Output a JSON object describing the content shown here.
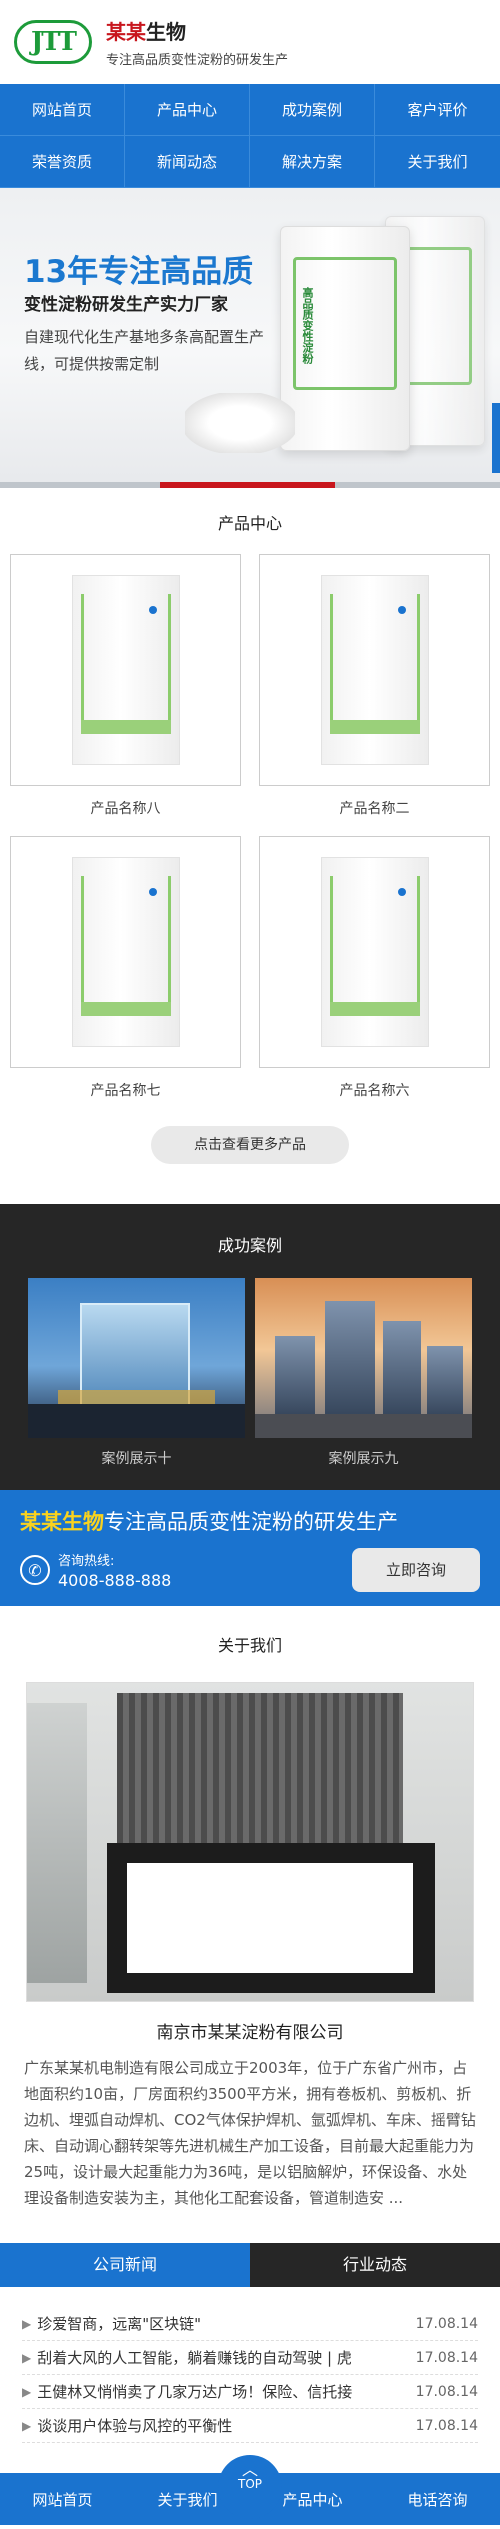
{
  "header": {
    "logo_mark": "JTT",
    "brand_red": "某某",
    "brand_rest": "生物",
    "slogan": "专注高品质变性淀粉的研发生产"
  },
  "nav": [
    "网站首页",
    "产品中心",
    "成功案例",
    "客户评价",
    "荣誉资质",
    "新闻动态",
    "解决方案",
    "关于我们"
  ],
  "banner": {
    "title": "13年专注高品质",
    "subtitle": "变性淀粉研发生产实力厂家",
    "desc": "自建现代化生产基地多条高配置生产线，可提供按需定制",
    "bag_text": "高品质变性淀粉"
  },
  "products": {
    "title": "产品中心",
    "items": [
      "产品名称八",
      "产品名称二",
      "产品名称七",
      "产品名称六"
    ],
    "more": "点击查看更多产品"
  },
  "cases": {
    "title": "成功案例",
    "items": [
      "案例展示十",
      "案例展示九"
    ]
  },
  "promo": {
    "brand": "某某生物",
    "text": "专注高品质变性淀粉的研发生产",
    "hotline_label": "咨询热线:",
    "hotline": "4008-888-888",
    "consult": "立即咨询"
  },
  "about": {
    "title": "关于我们",
    "company": "南京市某某淀粉有限公司",
    "text": "广东某某机电制造有限公司成立于2003年，位于广东省广州市，占地面积约10亩，厂房面积约3500平方米，拥有卷板机、剪板机、折边机、埋弧自动焊机、CO2气体保护焊机、氩弧焊机、车床、摇臂钻床、自动调心翻转架等先进机械生产加工设备，目前最大起重能力为25吨，设计最大起重能力为36吨，是以铝脑解炉，环保设备、水处理设备制造安装为主，其他化工配套设备，管道制造安 ..."
  },
  "news": {
    "tabs": [
      "公司新闻",
      "行业动态"
    ],
    "items": [
      {
        "title": "珍爱智商，远离\"区块链\"",
        "date": "17.08.14"
      },
      {
        "title": "刮着大风的人工智能，躺着赚钱的自动驾驶 | 虎",
        "date": "17.08.14"
      },
      {
        "title": "王健林又悄悄卖了几家万达广场！保险、信托接",
        "date": "17.08.14"
      },
      {
        "title": "谈谈用户体验与风控的平衡性",
        "date": "17.08.14"
      }
    ]
  },
  "footer": {
    "items": [
      "网站首页",
      "关于我们",
      "产品中心",
      "电话咨询"
    ],
    "top": "TOP"
  },
  "colors": {
    "primary": "#1a73cf",
    "brand_red": "#c8161d",
    "logo_green": "#1d9b3a",
    "dark": "#262626",
    "promo_yellow": "#f9d21e"
  }
}
